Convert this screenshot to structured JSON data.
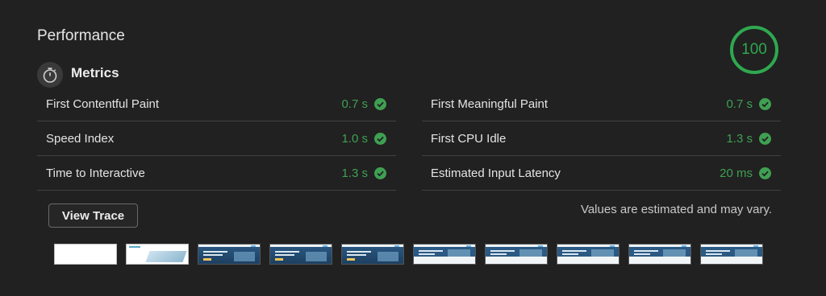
{
  "header": {
    "title": "Performance"
  },
  "score": {
    "value": "100",
    "fraction": 1.0,
    "color": "#2fa84f"
  },
  "section": {
    "icon": "stopwatch-icon",
    "title": "Metrics"
  },
  "metrics": [
    {
      "label": "First Contentful Paint",
      "value": "0.7 s",
      "status": "pass"
    },
    {
      "label": "First Meaningful Paint",
      "value": "0.7 s",
      "status": "pass"
    },
    {
      "label": "Speed Index",
      "value": "1.0 s",
      "status": "pass"
    },
    {
      "label": "First CPU Idle",
      "value": "1.3 s",
      "status": "pass"
    },
    {
      "label": "Time to Interactive",
      "value": "1.3 s",
      "status": "pass"
    },
    {
      "label": "Estimated Input Latency",
      "value": "20 ms",
      "status": "pass"
    }
  ],
  "actions": {
    "view_trace": "View Trace"
  },
  "disclaimer": "Values are estimated and may vary.",
  "filmstrip": [
    "blank",
    "partial",
    "hero",
    "hero",
    "hero",
    "hero2",
    "hero2",
    "hero2",
    "hero2",
    "hero2"
  ],
  "colors": {
    "pass": "#3fa052",
    "background": "#212121"
  }
}
